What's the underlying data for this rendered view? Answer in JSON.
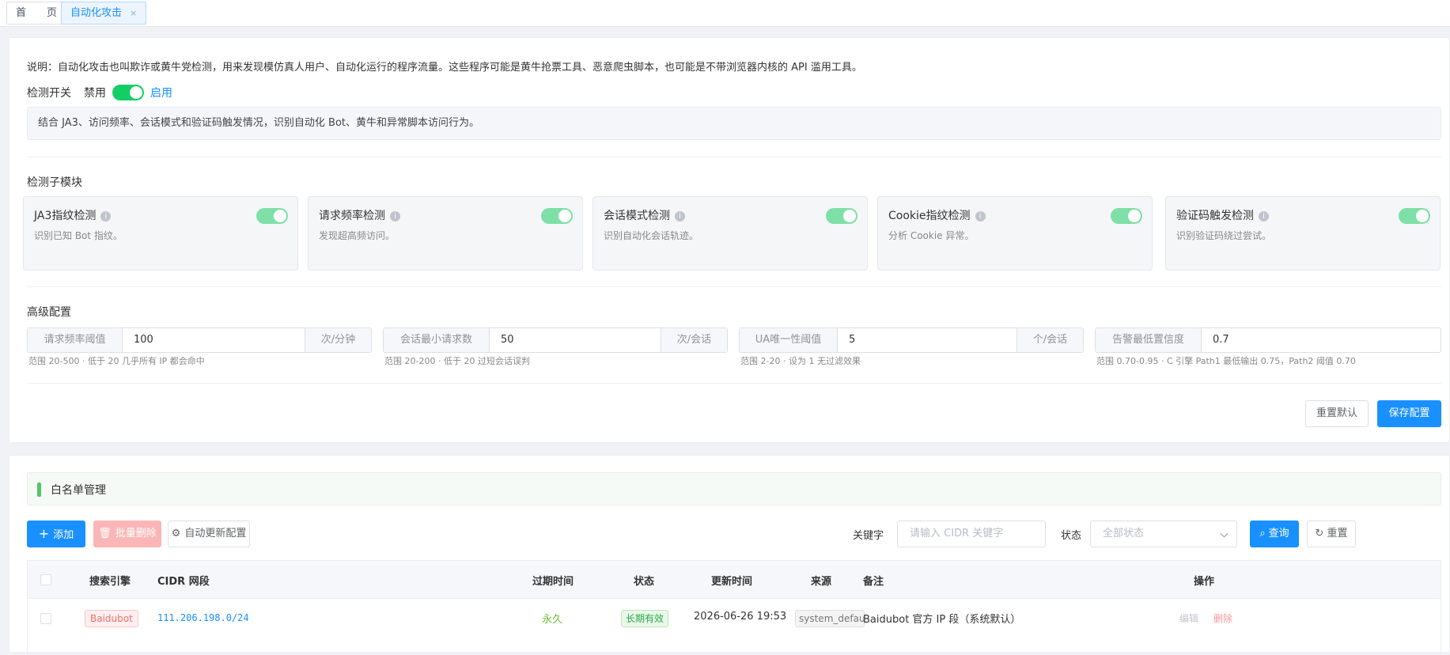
{
  "tabs": [
    {
      "label": "首　　页",
      "active": false
    },
    {
      "label": "自动化攻击",
      "active": true,
      "close": "×"
    }
  ],
  "description": "说明：自动化攻击也叫欺诈或黄牛党检测，用来发现模仿真人用户、自动化运行的程序流量。这些程序可能是黄牛抢票工具、恶意爬虫脚本，也可能是不带浏览器内核的 API 滥用工具。",
  "detection": {
    "label": "检测开关",
    "off_label": "禁用",
    "on_label": "启用",
    "enabled": true,
    "info": "结合 JA3、访问频率、会话模式和验证码触发情况，识别自动化 Bot、黄牛和异常脚本访问行为。"
  },
  "submodules": {
    "title": "检测子模块",
    "items": [
      {
        "name": "JA3指纹检测",
        "desc": "识别已知 Bot 指纹。",
        "enabled": true
      },
      {
        "name": "请求频率检测",
        "desc": "发现超高频访问。",
        "enabled": true
      },
      {
        "name": "会话模式检测",
        "desc": "识别自动化会话轨迹。",
        "enabled": true
      },
      {
        "name": "Cookie指纹检测",
        "desc": "分析 Cookie 异常。",
        "enabled": true
      },
      {
        "name": "验证码触发检测",
        "desc": "识别验证码绕过尝试。",
        "enabled": true
      }
    ]
  },
  "advanced": {
    "title": "高级配置",
    "fields": [
      {
        "prefix": "请求频率阈值",
        "value": "100",
        "suffix": "次/分钟",
        "hint": "范围 20-500 · 低于 20 几乎所有 IP 都会命中"
      },
      {
        "prefix": "会话最小请求数",
        "value": "50",
        "suffix": "次/会话",
        "hint": "范围 20-200 · 低于 20 过短会话误判"
      },
      {
        "prefix": "UA唯一性阈值",
        "value": "5",
        "suffix": "个/会话",
        "hint": "范围 2-20 · 设为 1 无过滤效果"
      },
      {
        "prefix": "告警最低置信度",
        "value": "0.7",
        "suffix": "",
        "hint": "范围 0.70-0.95 · C 引擎 Path1 最低输出 0.75，Path2 阈值 0.70"
      }
    ],
    "reset_label": "重置默认",
    "save_label": "保存配置"
  },
  "whitelist": {
    "title": "白名单管理",
    "add_label": "添加",
    "batch_delete_label": "批量删除",
    "auto_update_label": "自动更新配置",
    "keyword_label": "关键字",
    "keyword_placeholder": "请输入 CIDR 关键字",
    "status_label": "状态",
    "status_placeholder": "全部状态",
    "query_label": "查询",
    "reset_label": "重置",
    "columns": [
      "搜索引擎",
      "CIDR 网段",
      "过期时间",
      "状态",
      "更新时间",
      "来源",
      "备注",
      "操作"
    ],
    "rows": [
      {
        "engine": "Baidubot",
        "cidr": "111.206.198.0/24",
        "expire": "永久",
        "status": "长期有效",
        "updated": "2026-06-26 19:53",
        "source": "system_default",
        "remark": "Baidubot 官方 IP 段（系统默认）",
        "edit": "编辑",
        "delete": "删除"
      }
    ]
  }
}
